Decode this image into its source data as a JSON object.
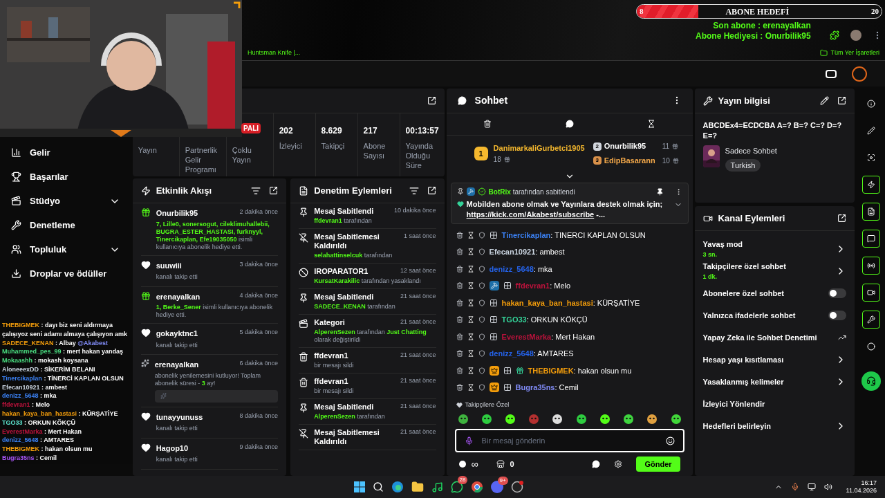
{
  "overlay": {
    "goal": {
      "current": "8",
      "title": "ABONE HEDEFİ",
      "target": "20",
      "level": 0.25
    },
    "last_sub": "Son abone : erenayalkan",
    "gift": "Abone Hediyesi : Onurbilik95",
    "live_badge": "PALI"
  },
  "browser": {
    "bookmark": "Huntsman Knife |...",
    "all_bookmarks": "Tüm Yer İşaretleri"
  },
  "sidebar": {
    "items": [
      {
        "label": "Gelir",
        "expandable": false
      },
      {
        "label": "Başarılar",
        "expandable": false
      },
      {
        "label": "Stüdyo",
        "expandable": true
      },
      {
        "label": "Denetleme",
        "expandable": false
      },
      {
        "label": "Topluluk",
        "expandable": true
      },
      {
        "label": "Droplar ve ödüller",
        "expandable": false
      }
    ]
  },
  "stats": {
    "tabs": [
      "Yayın",
      "Partnerlik Gelir Programı",
      "Çoklu Yayın"
    ],
    "metrics": [
      {
        "value": "202",
        "label": "İzleyici"
      },
      {
        "value": "8.629",
        "label": "Takipçi"
      },
      {
        "value": "217",
        "label": "Abone Sayısı"
      },
      {
        "value": "00:13:57",
        "label": "Yayında Olduğu Süre"
      }
    ]
  },
  "events": {
    "title": "Etkinlik Akışı",
    "items": [
      {
        "kind": "gift",
        "user": "Onurbilik95",
        "time": "2 dakika önce",
        "highlight": "7, Lille0, sonersogut, cileklimuhallebii, BUGRA_ESTER_HASTASI, furknyyl, Tinercikaplan, Efe19035050",
        "text": "isimli kullanıcıya abonelik hediye etti."
      },
      {
        "kind": "follow",
        "user": "suuwiii",
        "time": "3 dakika önce",
        "text": "kanalı takip etti"
      },
      {
        "kind": "gift",
        "user": "erenayalkan",
        "time": "4 dakika önce",
        "highlight": "1, Berke_Sener",
        "text": "isimli kullanıcıya abonelik hediye etti."
      },
      {
        "kind": "follow",
        "user": "gokayktnc1",
        "time": "5 dakika önce",
        "text": "kanalı takip etti"
      },
      {
        "kind": "renewal",
        "user": "erenayalkan",
        "time": "6 dakika önce",
        "text": "abonelik yenilemesini kutluyor! Toplam abonelik süresi - ",
        "highlight": "3",
        "suffix": " ay!"
      },
      {
        "kind": "follow",
        "user": "tunayyunuss",
        "time": "8 dakika önce",
        "text": "kanalı takip etti"
      },
      {
        "kind": "follow",
        "user": "Hagop10",
        "time": "9 dakika önce",
        "text": "kanalı takip etti"
      }
    ]
  },
  "moderation": {
    "title": "Denetim Eylemleri",
    "items": [
      {
        "kind": "pin",
        "title": "Mesaj Sabitlendi",
        "time": "10 dakika önce",
        "actor": "ffdevran1",
        "text": "tarafından"
      },
      {
        "kind": "unpin",
        "title": "Mesaj Sabitlemesi Kaldırıldı",
        "time": "1 saat önce",
        "actor": "selahattinselcuk",
        "text": "tarafından"
      },
      {
        "kind": "ban",
        "title": "IROPARATOR1",
        "time": "12 saat önce",
        "actor": "KursatKarakilic",
        "text": "tarafından yasaklandı"
      },
      {
        "kind": "pin",
        "title": "Mesaj Sabitlendi",
        "time": "21 saat önce",
        "actor": "SADECE_KENAN",
        "text": "tarafından"
      },
      {
        "kind": "category",
        "title": "Kategori",
        "time": "21 saat önce",
        "actor": "AlperenSezen",
        "text": "tarafından",
        "category": "Just Chatting",
        "suffix": "olarak değiştirildi"
      },
      {
        "kind": "delete",
        "title": "ffdevran1",
        "time": "21 saat önce",
        "text": "bir mesajı sildi"
      },
      {
        "kind": "delete",
        "title": "ffdevran1",
        "time": "21 saat önce",
        "text": "bir mesajı sildi"
      },
      {
        "kind": "pin",
        "title": "Mesaj Sabitlendi",
        "time": "21 saat önce",
        "actor": "AlperenSezen",
        "text": "tarafından"
      },
      {
        "kind": "unpin",
        "title": "Mesaj Sabitlemesi Kaldırıldı",
        "time": "21 saat önce"
      }
    ]
  },
  "chat": {
    "title": "Sohbet",
    "leaderboard": [
      {
        "rank": "1",
        "user": "DanimarkaliGurbetci1905",
        "count": "18"
      },
      {
        "rank": "2",
        "user": "Onurbilik95",
        "count": "11"
      },
      {
        "rank": "3",
        "user": "EdipBasarann",
        "count": "10"
      }
    ],
    "pinned": {
      "by": "BotRix",
      "by_text": "tarafından sabitlendi",
      "message": "Mobilden abone olmak ve Yayınlara destek olmak için;",
      "link": "https://kick.com/Akabest/subscribe",
      "after": "-..."
    },
    "messages": [
      {
        "user": "Tinercikaplan",
        "color": "#3b82f6",
        "text": ": TINERCI KAPLAN OLSUN",
        "badges": [
          {
            "kind": "sub"
          }
        ]
      },
      {
        "user": "Efecan10921",
        "color": "#cbd5e1",
        "text": ": ambest"
      },
      {
        "user": "denizz_5648",
        "color": "#2563eb",
        "text": ": mka"
      },
      {
        "user": "ffdevran1",
        "color": "#be123c",
        "text": ": Melo",
        "badges": [
          {
            "kind": "mod"
          },
          {
            "kind": "sub"
          }
        ]
      },
      {
        "user": "hakan_kaya_ban_hastasi",
        "color": "#f59e0b",
        "text": ": KÜRŞATİYE",
        "badges": [
          {
            "kind": "sub"
          }
        ]
      },
      {
        "user": "TGO33",
        "color": "#34d399",
        "text": ": ORKUN KÖKÇÜ",
        "badges": [
          {
            "kind": "sub"
          }
        ]
      },
      {
        "user": "EverestMarka",
        "color": "#be123c",
        "text": ": Mert Hakan",
        "badges": [
          {
            "kind": "sub"
          }
        ]
      },
      {
        "user": "denizz_5648",
        "color": "#2563eb",
        "text": ": AMTARES"
      },
      {
        "user": "THEBIGMEK",
        "color": "#f59e0b",
        "text": ": hakan olsun mu",
        "badges": [
          {
            "kind": "crown"
          },
          {
            "kind": "sub"
          },
          {
            "kind": "gift"
          }
        ]
      },
      {
        "user": "Bugra35ns",
        "color": "#818cf8",
        "text": ": Cemil",
        "badges": [
          {
            "kind": "crown"
          },
          {
            "kind": "sub"
          }
        ]
      }
    ],
    "emote_label": "Takipçilere Özel",
    "input": {
      "placeholder": "Bir mesaj gönderin"
    },
    "points": "∞",
    "store_count": "0",
    "send": "Gönder"
  },
  "stream_info": {
    "title": "Yayın bilgisi",
    "stream_title": "ABCDEx4=ECDCBA A=? B=? C=? D=? E=?",
    "category": "Sadece Sohbet",
    "tag": "Turkish"
  },
  "channel_actions": {
    "title": "Kanal Eylemleri",
    "items": [
      {
        "kind": "link",
        "label": "Yavaş mod",
        "value": "3 sn."
      },
      {
        "kind": "link",
        "label": "Takipçilere özel sohbet",
        "value": "1 dk."
      },
      {
        "kind": "toggle",
        "label": "Abonelere özel sohbet",
        "on": false
      },
      {
        "kind": "toggle",
        "label": "Yalnızca ifadelerle sohbet",
        "on": false
      },
      {
        "kind": "external",
        "label": "Yapay Zeka ile Sohbet Denetimi"
      },
      {
        "kind": "link",
        "label": "Hesap yaşı kısıtlaması"
      },
      {
        "kind": "link",
        "label": "Yasaklanmış kelimeler"
      },
      {
        "kind": "plain",
        "label": "İzleyici Yönlendir"
      },
      {
        "kind": "link",
        "label": "Hedefleri belirleyin"
      }
    ]
  },
  "rail": [
    {
      "active": false
    },
    {
      "active": false
    },
    {
      "active": false
    },
    {
      "active": true
    },
    {
      "active": true
    },
    {
      "active": true
    },
    {
      "active": true
    },
    {
      "active": true
    },
    {
      "active": true
    },
    {
      "active": false
    }
  ],
  "stream_chat_overlay": [
    {
      "user": "THEBIGMEK",
      "color": "#f59e0b",
      "text": ": dayı biz seni aldırmaya çalışıyoz seni adamı almaya çalışıyon amk"
    },
    {
      "user": "SADECE_KENAN",
      "color": "#f59e0b",
      "text": ": Albay",
      "mention": "@Akabest"
    },
    {
      "user": "Muhammed_pes_99",
      "color": "#4ade80",
      "text": ": mert hakan yandaş"
    },
    {
      "user": "Mokaashh",
      "color": "#4ade80",
      "text": ": mokash koysana"
    },
    {
      "user": "AloneeexDD",
      "color": "#cbd5e1",
      "text": ": SİKERİM BELANI"
    },
    {
      "user": "Tinercikaplan",
      "color": "#3b82f6",
      "text": ": TİNERCİ KAPLAN OLSUN"
    },
    {
      "user": "Efecan10921",
      "color": "#cbd5e1",
      "text": ": ambest"
    },
    {
      "user": "denizz_5648",
      "color": "#3b82f6",
      "text": ": mka"
    },
    {
      "user": "ffdevran1",
      "color": "#be123c",
      "text": ": Melo"
    },
    {
      "user": "hakan_kaya_ban_hastasi",
      "color": "#f59e0b",
      "text": ": KÜRŞATİYE"
    },
    {
      "user": "TGO33",
      "color": "#5eead4",
      "text": ": ORKUN KÖKÇÜ"
    },
    {
      "user": "EverestMarka",
      "color": "#be123c",
      "text": ": Mert Hakan"
    },
    {
      "user": "denizz_5648",
      "color": "#3b82f6",
      "text": ": AMTARES"
    },
    {
      "user": "THEBIGMEK",
      "color": "#f59e0b",
      "text": ": hakan olsun mu"
    },
    {
      "user": "Bugra35ns",
      "color": "#a855f7",
      "text": ": Cemil"
    }
  ],
  "taskbar": {
    "whatsapp_badge": "28",
    "discord_badge": "9+",
    "time": "16:17",
    "date": "11.04.2026"
  }
}
